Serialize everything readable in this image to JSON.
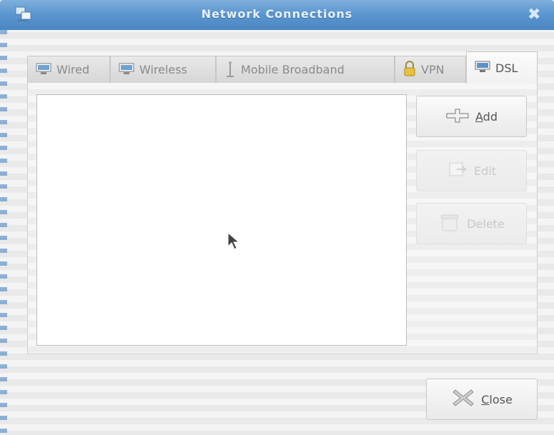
{
  "window": {
    "title": "Network Connections"
  },
  "tabs": [
    {
      "label": "Wired",
      "icon": "wired-network-icon",
      "active": false
    },
    {
      "label": "Wireless",
      "icon": "wireless-network-icon",
      "active": false
    },
    {
      "label": "Mobile Broadband",
      "icon": "antenna-icon",
      "active": false
    },
    {
      "label": "VPN",
      "icon": "lock-icon",
      "active": false
    },
    {
      "label": "DSL",
      "icon": "dsl-network-icon",
      "active": true
    }
  ],
  "actions": {
    "add": {
      "label": "Add",
      "mnemonic": "A",
      "icon": "add-icon",
      "enabled": true
    },
    "edit": {
      "label": "Edit",
      "icon": "edit-icon",
      "enabled": false
    },
    "delete": {
      "label": "Delete",
      "icon": "trash-icon",
      "enabled": false
    }
  },
  "footer": {
    "close": {
      "label": "Close",
      "mnemonic": "C",
      "icon": "close-icon"
    }
  },
  "colors": {
    "titlebar": "#5d97cf",
    "panel_bg": "#f6f6f6"
  }
}
